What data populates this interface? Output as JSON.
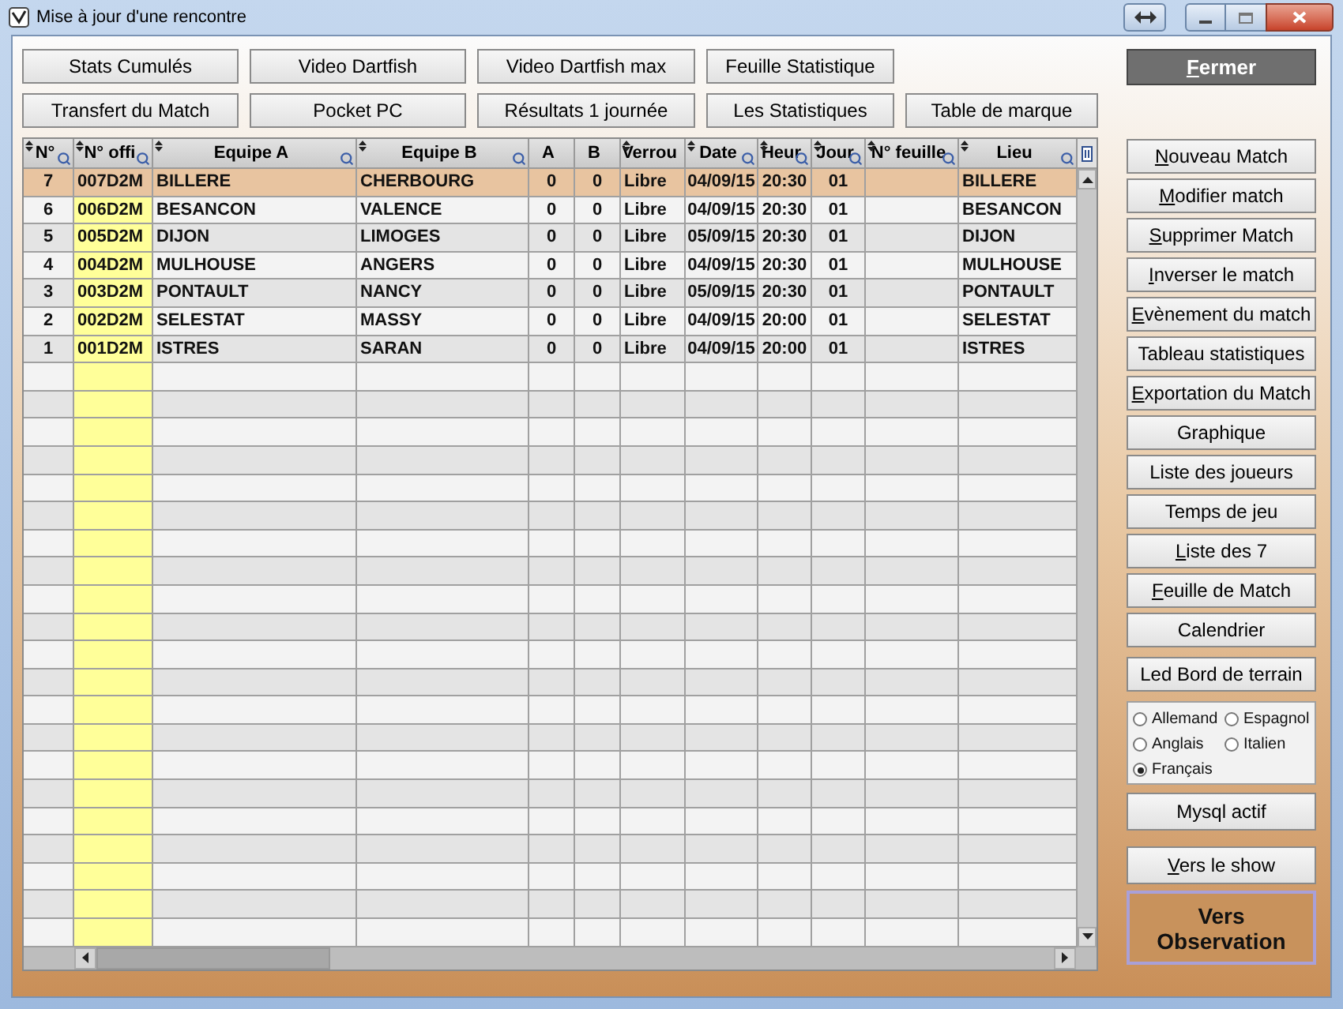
{
  "window": {
    "title": "Mise à jour d'une rencontre"
  },
  "top_buttons": [
    [
      {
        "post": "Stats Cumulés"
      },
      {
        "post": "Video Dartfish"
      },
      {
        "post": "Video Dartfish max"
      },
      {
        "post": "Feuille Statistique"
      }
    ],
    [
      {
        "post": "Transfert du Match"
      },
      {
        "post": "Pocket PC"
      },
      {
        "post": "Résultats 1 journée"
      },
      {
        "post": "Les Statistiques"
      },
      {
        "post": "Table de marque"
      }
    ]
  ],
  "close_button": {
    "key": "F",
    "post": "ermer"
  },
  "table": {
    "columns": [
      {
        "label": "N°",
        "sortable": true,
        "searchable": true
      },
      {
        "label": "N° offi",
        "sortable": true,
        "searchable": true
      },
      {
        "label": "Equipe A",
        "sortable": true,
        "searchable": true
      },
      {
        "label": "Equipe B",
        "sortable": true,
        "searchable": true
      },
      {
        "label": "A",
        "sortable": false,
        "searchable": false
      },
      {
        "label": "B",
        "sortable": false,
        "searchable": false
      },
      {
        "label": "Verrou",
        "sortable": true,
        "searchable": false
      },
      {
        "label": "Date",
        "sortable": true,
        "searchable": true
      },
      {
        "label": "Heur",
        "sortable": true,
        "searchable": true
      },
      {
        "label": "Jour",
        "sortable": true,
        "searchable": true
      },
      {
        "label": "N° feuille",
        "sortable": true,
        "searchable": true
      },
      {
        "label": "Lieu",
        "sortable": true,
        "searchable": true
      }
    ],
    "rows": [
      {
        "selected": true,
        "cells": [
          "7",
          "007D2M",
          "BILLERE",
          "CHERBOURG",
          "0",
          "0",
          "Libre",
          "04/09/15",
          "20:30",
          "01",
          null,
          "BILLERE"
        ]
      },
      {
        "selected": false,
        "cells": [
          "6",
          "006D2M",
          "BESANCON",
          "VALENCE",
          "0",
          "0",
          "Libre",
          "04/09/15",
          "20:30",
          "01",
          null,
          "BESANCON"
        ]
      },
      {
        "selected": false,
        "cells": [
          "5",
          "005D2M",
          "DIJON",
          "LIMOGES",
          "0",
          "0",
          "Libre",
          "05/09/15",
          "20:30",
          "01",
          null,
          "DIJON"
        ]
      },
      {
        "selected": false,
        "cells": [
          "4",
          "004D2M",
          "MULHOUSE",
          "ANGERS",
          "0",
          "0",
          "Libre",
          "04/09/15",
          "20:30",
          "01",
          null,
          "MULHOUSE"
        ]
      },
      {
        "selected": false,
        "cells": [
          "3",
          "003D2M",
          "PONTAULT",
          "NANCY",
          "0",
          "0",
          "Libre",
          "05/09/15",
          "20:30",
          "01",
          null,
          "PONTAULT"
        ]
      },
      {
        "selected": false,
        "cells": [
          "2",
          "002D2M",
          "SELESTAT",
          "MASSY",
          "0",
          "0",
          "Libre",
          "04/09/15",
          "20:00",
          "01",
          null,
          "SELESTAT"
        ]
      },
      {
        "selected": false,
        "cells": [
          "1",
          "001D2M",
          "ISTRES",
          "SARAN",
          "0",
          "0",
          "Libre",
          "04/09/15",
          "20:00",
          "01",
          null,
          "ISTRES"
        ]
      }
    ]
  },
  "side_buttons": [
    {
      "key": "N",
      "post": "ouveau Match"
    },
    {
      "key": "M",
      "post": "odifier match"
    },
    {
      "key": "S",
      "post": "upprimer Match"
    },
    {
      "key": "I",
      "post": "nverser le match"
    },
    {
      "key": "E",
      "post": "vènement du match"
    },
    {
      "post": "Tableau statistiques"
    },
    {
      "key": "E",
      "post": "xportation du Match"
    },
    {
      "post": "Graphique"
    },
    {
      "post": "Liste des joueurs"
    },
    {
      "post": "Temps de jeu"
    },
    {
      "key": "L",
      "post": "iste des 7"
    },
    {
      "key": "F",
      "post": "euille de Match"
    },
    {
      "post": "Calendrier"
    }
  ],
  "led_button": {
    "post": "Led Bord de terrain"
  },
  "languages": [
    {
      "label": "Allemand",
      "selected": false
    },
    {
      "label": "Espagnol",
      "selected": false
    },
    {
      "label": "Anglais",
      "selected": false
    },
    {
      "label": "Italien",
      "selected": false
    },
    {
      "label": "Français",
      "selected": true
    }
  ],
  "mysql_button": {
    "post": "Mysql actif"
  },
  "show_button": {
    "key": "V",
    "post": "ers le show"
  },
  "observation_button": {
    "label": "Vers Observation"
  }
}
